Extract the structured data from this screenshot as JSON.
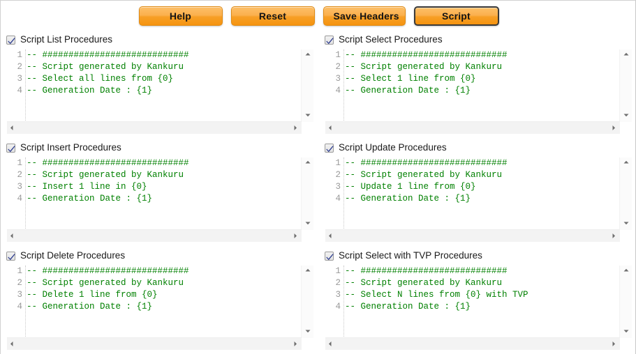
{
  "toolbar": {
    "buttons": [
      {
        "label": "Help",
        "name": "help-button",
        "focused": false
      },
      {
        "label": "Reset",
        "name": "reset-button",
        "focused": false
      },
      {
        "label": "Save Headers",
        "name": "save-headers-button",
        "focused": false
      },
      {
        "label": "Script",
        "name": "script-button",
        "focused": true
      }
    ]
  },
  "colors": {
    "button_orange_top": "#fdc068",
    "button_orange_bottom": "#f59410",
    "button_border": "#e08a13",
    "button_focus_border": "#3a3a3a",
    "code_green": "#008000",
    "line_number_gray": "#9a9a9a",
    "checkbox_check_blue": "#2b3b8f",
    "scrollbar_track": "#f3f3f3",
    "scrollbar_arrow": "#6e6e6e",
    "page_background": "#ffffff"
  },
  "icons": {
    "checkbox_checked": "check-icon",
    "scroll_up": "triangle-up-icon",
    "scroll_down": "triangle-down-icon",
    "scroll_left": "triangle-left-icon",
    "scroll_right": "triangle-right-icon"
  },
  "panels": [
    {
      "id": "script-list-procedures",
      "checked": true,
      "label": "Script List Procedures",
      "line_numbers": [
        "1",
        "2",
        "3",
        "4"
      ],
      "lines": [
        "-- ############################",
        "-- Script generated by Kankuru",
        "-- Select all lines from {0}",
        "-- Generation Date : {1}"
      ]
    },
    {
      "id": "script-select-procedures",
      "checked": true,
      "label": "Script Select Procedures",
      "line_numbers": [
        "1",
        "2",
        "3",
        "4"
      ],
      "lines": [
        "-- ############################",
        "-- Script generated by Kankuru",
        "-- Select 1 line from {0}",
        "-- Generation Date : {1}"
      ]
    },
    {
      "id": "script-insert-procedures",
      "checked": true,
      "label": "Script Insert Procedures",
      "line_numbers": [
        "1",
        "2",
        "3",
        "4"
      ],
      "lines": [
        "-- ############################",
        "-- Script generated by Kankuru",
        "-- Insert 1 line in {0}",
        "-- Generation Date : {1}"
      ]
    },
    {
      "id": "script-update-procedures",
      "checked": true,
      "label": "Script Update Procedures",
      "line_numbers": [
        "1",
        "2",
        "3",
        "4"
      ],
      "lines": [
        "-- ############################",
        "-- Script generated by Kankuru",
        "-- Update 1 line from {0}",
        "-- Generation Date : {1}"
      ]
    },
    {
      "id": "script-delete-procedures",
      "checked": true,
      "label": "Script Delete Procedures",
      "line_numbers": [
        "1",
        "2",
        "3",
        "4"
      ],
      "lines": [
        "-- ############################",
        "-- Script generated by Kankuru",
        "-- Delete 1 line from {0}",
        "-- Generation Date : {1}"
      ]
    },
    {
      "id": "script-select-with-tvp-procedures",
      "checked": true,
      "label": "Script Select with TVP Procedures",
      "line_numbers": [
        "1",
        "2",
        "3",
        "4"
      ],
      "lines": [
        "-- ############################",
        "-- Script generated by Kankuru",
        "-- Select N lines from {0} with TVP",
        "-- Generation Date : {1}"
      ]
    }
  ]
}
